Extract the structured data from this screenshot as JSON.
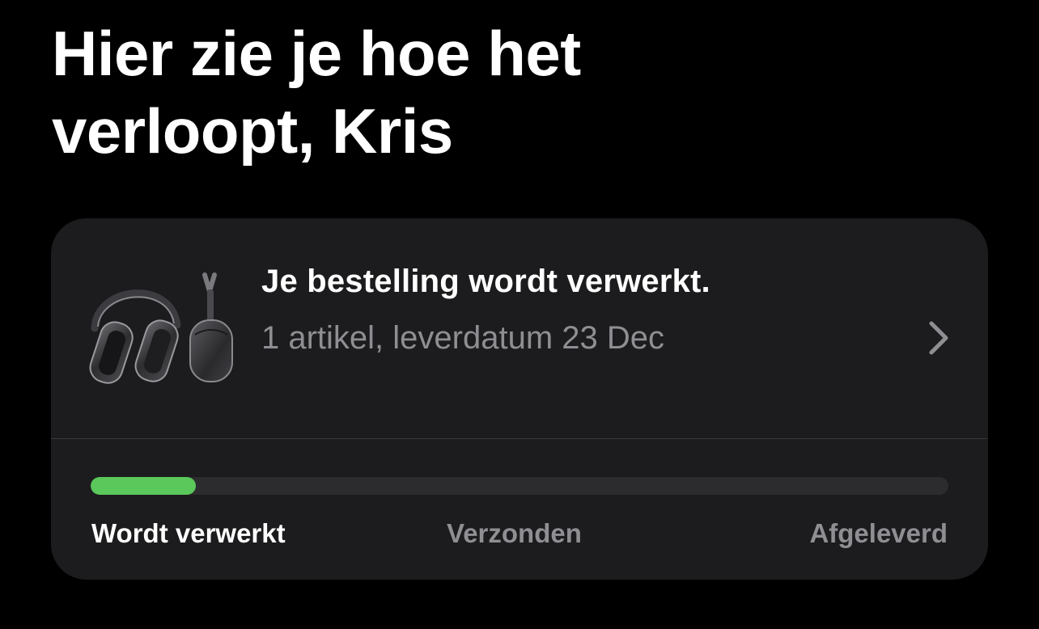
{
  "page": {
    "title_lines": [
      "Hier zie je hoe het",
      "verloopt, Kris"
    ]
  },
  "order": {
    "product_icon": "airpods-max-headphones",
    "status": "Je bestelling wordt verwerkt.",
    "details": "1 artikel, leverdatum 23 Dec",
    "chevron_icon": "chevron-right-icon"
  },
  "progress": {
    "fraction": 0.123,
    "fill_color": "#5ac85a",
    "track_color": "#2c2c2e",
    "steps": [
      {
        "label": "Wordt verwerkt",
        "active": true
      },
      {
        "label": "Verzonden",
        "active": false
      },
      {
        "label": "Afgeleverd",
        "active": false
      }
    ]
  },
  "colors": {
    "background": "#000000",
    "card": "#1c1c1e",
    "primary_text": "#ffffff",
    "secondary_text": "#8e8e93"
  }
}
